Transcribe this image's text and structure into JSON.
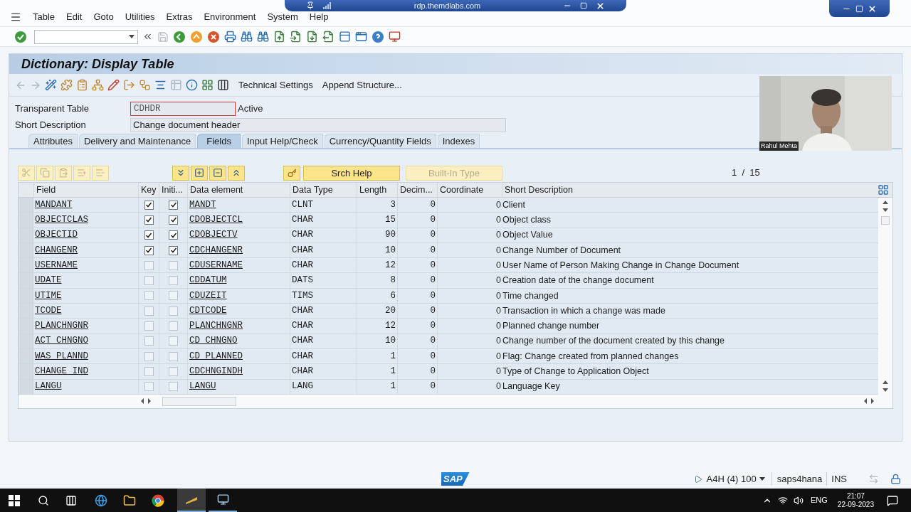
{
  "menu": [
    "Table",
    "Edit",
    "Goto",
    "Utilities",
    "Extras",
    "Environment",
    "System",
    "Help"
  ],
  "remote_bar": {
    "title": "rdp.themdlabs.com"
  },
  "title": "Dictionary: Display Table",
  "app_toolbar": [
    "Technical Settings",
    "Append Structure..."
  ],
  "header_fields": [
    {
      "label": "Transparent Table",
      "value": "CDHDR",
      "status": "Active"
    },
    {
      "label": "Short Description",
      "value": "Change document header"
    }
  ],
  "tabs": [
    {
      "label": "Attributes",
      "selected": false
    },
    {
      "label": "Delivery and Maintenance",
      "selected": false
    },
    {
      "label": "Fields",
      "selected": true
    },
    {
      "label": "Input Help/Check",
      "selected": false
    },
    {
      "label": "Currency/Quantity Fields",
      "selected": false
    },
    {
      "label": "Indexes",
      "selected": false
    }
  ],
  "table_buttons": [
    {
      "label": "Srch Help",
      "disabled": false
    },
    {
      "label": "Built-In Type",
      "disabled": true
    }
  ],
  "pager": "1  /  15",
  "table": {
    "columns": [
      "Field",
      "Key",
      "Initi...",
      "Data element",
      "Data Type",
      "Length",
      "Decim...",
      "Coordinate",
      "Short Description"
    ],
    "rows": [
      {
        "field": "MANDANT",
        "key": true,
        "initial": true,
        "data_element": "MANDT",
        "data_type": "CLNT",
        "length": "3",
        "decimals": "0",
        "coordinate": "0",
        "description": "Client"
      },
      {
        "field": "OBJECTCLAS",
        "key": true,
        "initial": true,
        "data_element": "CDOBJECTCL",
        "data_type": "CHAR",
        "length": "15",
        "decimals": "0",
        "coordinate": "0",
        "description": "Object class"
      },
      {
        "field": "OBJECTID",
        "key": true,
        "initial": true,
        "data_element": "CDOBJECTV",
        "data_type": "CHAR",
        "length": "90",
        "decimals": "0",
        "coordinate": "0",
        "description": "Object Value"
      },
      {
        "field": "CHANGENR",
        "key": true,
        "initial": true,
        "data_element": "CDCHANGENR",
        "data_type": "CHAR",
        "length": "10",
        "decimals": "0",
        "coordinate": "0",
        "description": "Change Number of Document"
      },
      {
        "field": "USERNAME",
        "key": false,
        "initial": false,
        "data_element": "CDUSERNAME",
        "data_type": "CHAR",
        "length": "12",
        "decimals": "0",
        "coordinate": "0",
        "description": "User Name of Person Making Change in Change Document"
      },
      {
        "field": "UDATE",
        "key": false,
        "initial": false,
        "data_element": "CDDATUM",
        "data_type": "DATS",
        "length": "8",
        "decimals": "0",
        "coordinate": "0",
        "description": "Creation date of the change document"
      },
      {
        "field": "UTIME",
        "key": false,
        "initial": false,
        "data_element": "CDUZEIT",
        "data_type": "TIMS",
        "length": "6",
        "decimals": "0",
        "coordinate": "0",
        "description": "Time changed"
      },
      {
        "field": "TCODE",
        "key": false,
        "initial": false,
        "data_element": "CDTCODE",
        "data_type": "CHAR",
        "length": "20",
        "decimals": "0",
        "coordinate": "0",
        "description": "Transaction in which a change was made"
      },
      {
        "field": "PLANCHNGNR",
        "key": false,
        "initial": false,
        "data_element": "PLANCHNGNR",
        "data_type": "CHAR",
        "length": "12",
        "decimals": "0",
        "coordinate": "0",
        "description": "Planned change number"
      },
      {
        "field": "ACT CHNGNO",
        "key": false,
        "initial": false,
        "data_element": "CD CHNGNO",
        "data_type": "CHAR",
        "length": "10",
        "decimals": "0",
        "coordinate": "0",
        "description": "Change number of the document created by this change"
      },
      {
        "field": "WAS PLANND",
        "key": false,
        "initial": false,
        "data_element": "CD PLANNED",
        "data_type": "CHAR",
        "length": "1",
        "decimals": "0",
        "coordinate": "0",
        "description": "Flag: Change created from planned changes"
      },
      {
        "field": "CHANGE IND",
        "key": false,
        "initial": false,
        "data_element": "CDCHNGINDH",
        "data_type": "CHAR",
        "length": "1",
        "decimals": "0",
        "coordinate": "0",
        "description": "Type of Change to Application Object"
      },
      {
        "field": "LANGU",
        "key": false,
        "initial": false,
        "data_element": "LANGU",
        "data_type": "LANG",
        "length": "1",
        "decimals": "0",
        "coordinate": "0",
        "description": "Language Key"
      }
    ]
  },
  "video": {
    "caption": "Rahul Mehta"
  },
  "status_bar": {
    "logo": "SAP",
    "system": "A4H (4) 100",
    "server": "saps4hana",
    "mode": "INS"
  },
  "taskbar": {
    "language": "ENG",
    "time": "21:07",
    "date": "22-09-2023"
  }
}
